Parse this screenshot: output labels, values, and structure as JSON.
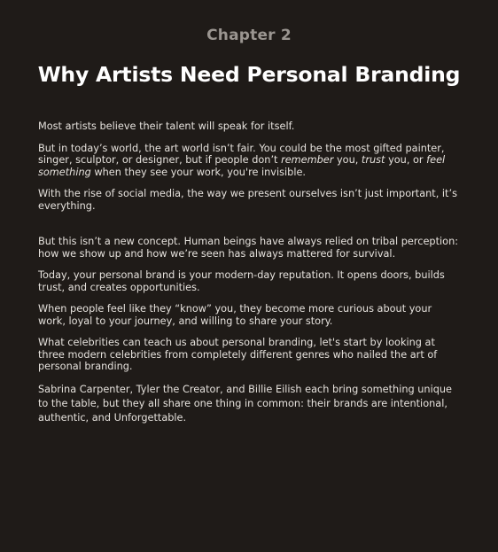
{
  "chapter": {
    "label": "Chapter 2",
    "title": "Why Artists Need Personal Branding"
  },
  "paragraphs": {
    "p1": "Most artists believe their talent will speak for itself.",
    "p2": {
      "a": "But in today’s world, the art world isn’t fair. You could be the most gifted painter, singer, sculptor, or designer, but if people don’t ",
      "b": "remember",
      "c": " you, ",
      "d": "trust",
      "e": " you, or ",
      "f": "feel something",
      "g": " when they see your work, you're invisible."
    },
    "p3": "With the rise of social media, the way we present ourselves isn’t just important, it’s everything.",
    "p4": "But this isn’t a new concept. Human beings have always relied on tribal perception: how we show up and how we’re seen has always mattered for survival.",
    "p5": "Today, your personal brand is your modern-day reputation. It opens doors, builds trust, and creates opportunities.",
    "p6": "When people feel like they “know” you, they become more curious about your work, loyal to your journey, and willing to share your story.",
    "p7": "What celebrities can teach us about personal branding, let's start by looking at three modern celebrities from completely different genres who nailed the art of personal branding.",
    "p8": "Sabrina Carpenter, Tyler the Creator, and Billie Eilish each bring something unique to the table, but they all share one thing in common: their brands are intentional, authentic, and Unforgettable."
  }
}
